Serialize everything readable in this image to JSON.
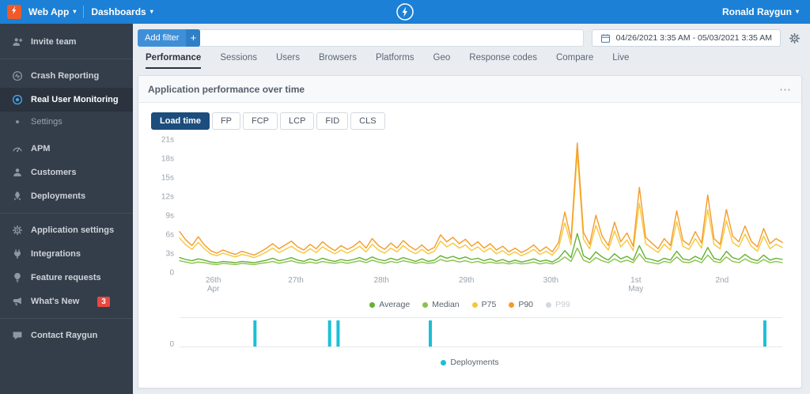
{
  "topbar": {
    "app_label": "Web App",
    "dashboards_label": "Dashboards",
    "user_label": "Ronald Raygun",
    "caret": "▾"
  },
  "sidebar": {
    "badge": "3",
    "items": [
      {
        "label": "Invite team"
      },
      {
        "label": "Crash Reporting"
      },
      {
        "label": "Real User Monitoring"
      },
      {
        "label": "Settings"
      },
      {
        "label": "APM"
      },
      {
        "label": "Customers"
      },
      {
        "label": "Deployments"
      },
      {
        "label": "Application settings"
      },
      {
        "label": "Integrations"
      },
      {
        "label": "Feature requests"
      },
      {
        "label": "What's New"
      },
      {
        "label": "Contact Raygun"
      }
    ]
  },
  "filters": {
    "add_filter_label": "Add filter",
    "add_filter_plus": "+",
    "date_range": "04/26/2021 3:35 AM - 05/03/2021 3:35 AM"
  },
  "tabs": [
    "Performance",
    "Sessions",
    "Users",
    "Browsers",
    "Platforms",
    "Geo",
    "Response codes",
    "Compare",
    "Live"
  ],
  "card": {
    "title": "Application performance over time",
    "menu_icon": "⋯"
  },
  "chips": [
    "Load time",
    "FP",
    "FCP",
    "LCP",
    "FID",
    "CLS"
  ],
  "chart_data": [
    {
      "type": "line",
      "title": "Application performance over time",
      "unit": "s",
      "ylim": [
        0,
        21
      ],
      "yticks": [
        0,
        3,
        6,
        9,
        12,
        15,
        18,
        21
      ],
      "legend_position": "bottom",
      "x_ticks": [
        {
          "label": "26th",
          "sub": "Apr",
          "frac": 0.056
        },
        {
          "label": "27th",
          "frac": 0.193
        },
        {
          "label": "28th",
          "frac": 0.335
        },
        {
          "label": "29th",
          "frac": 0.476
        },
        {
          "label": "30th",
          "frac": 0.616
        },
        {
          "label": "1st",
          "sub": "May",
          "frac": 0.757
        },
        {
          "label": "2nd",
          "frac": 0.9
        }
      ],
      "series": [
        {
          "name": "Average",
          "color": "#62b22f",
          "enabled": true,
          "values": [
            2.3,
            2.0,
            1.8,
            2.1,
            1.9,
            1.6,
            1.5,
            1.7,
            1.6,
            1.5,
            1.7,
            1.6,
            1.5,
            1.7,
            1.9,
            2.2,
            1.8,
            2.0,
            2.3,
            1.9,
            1.7,
            2.1,
            1.8,
            2.2,
            1.9,
            1.7,
            2.0,
            1.8,
            2.0,
            2.3,
            1.9,
            2.4,
            2.0,
            1.8,
            2.2,
            1.9,
            2.3,
            2.0,
            1.7,
            2.1,
            1.7,
            1.9,
            2.6,
            2.2,
            2.5,
            2.1,
            2.4,
            2.0,
            2.2,
            1.8,
            2.1,
            1.7,
            2.0,
            1.6,
            1.9,
            1.6,
            1.8,
            2.1,
            1.7,
            1.9,
            1.6,
            2.2,
            3.4,
            2.3,
            6.1,
            2.6,
            2.0,
            3.2,
            2.4,
            1.9,
            2.9,
            2.1,
            2.5,
            1.9,
            4.2,
            2.2,
            2.0,
            1.7,
            2.2,
            1.9,
            3.3,
            2.1,
            1.9,
            2.5,
            2.0,
            3.9,
            2.2,
            1.9,
            3.3,
            2.3,
            2.0,
            2.8,
            2.1,
            1.8,
            2.7,
            1.9,
            2.2,
            2.0
          ]
        },
        {
          "name": "Median",
          "color": "#8ac24a",
          "enabled": true,
          "values": [
            1.8,
            1.6,
            1.4,
            1.6,
            1.5,
            1.3,
            1.2,
            1.4,
            1.3,
            1.2,
            1.4,
            1.3,
            1.2,
            1.4,
            1.5,
            1.7,
            1.4,
            1.6,
            1.8,
            1.5,
            1.4,
            1.6,
            1.4,
            1.7,
            1.5,
            1.4,
            1.6,
            1.4,
            1.6,
            1.8,
            1.5,
            1.9,
            1.6,
            1.4,
            1.7,
            1.5,
            1.8,
            1.6,
            1.4,
            1.6,
            1.4,
            1.5,
            2.0,
            1.7,
            1.9,
            1.6,
            1.8,
            1.5,
            1.7,
            1.4,
            1.6,
            1.4,
            1.5,
            1.3,
            1.5,
            1.3,
            1.4,
            1.6,
            1.3,
            1.5,
            1.3,
            1.7,
            2.4,
            1.7,
            3.8,
            1.9,
            1.5,
            2.3,
            1.8,
            1.5,
            2.1,
            1.6,
            1.9,
            1.5,
            2.9,
            1.7,
            1.5,
            1.3,
            1.7,
            1.5,
            2.4,
            1.6,
            1.5,
            1.9,
            1.5,
            2.7,
            1.7,
            1.5,
            2.4,
            1.7,
            1.5,
            2.1,
            1.6,
            1.4,
            2.0,
            1.5,
            1.7,
            1.5
          ]
        },
        {
          "name": "P75",
          "color": "#f5c83b",
          "enabled": true,
          "values": [
            5.4,
            4.3,
            3.6,
            4.7,
            3.7,
            2.9,
            2.6,
            3.0,
            2.7,
            2.4,
            2.8,
            2.6,
            2.3,
            2.7,
            3.2,
            3.8,
            3.1,
            3.6,
            4.1,
            3.4,
            3.0,
            3.7,
            3.1,
            4.0,
            3.4,
            2.9,
            3.5,
            3.0,
            3.5,
            4.1,
            3.2,
            4.4,
            3.5,
            3.0,
            3.8,
            3.2,
            4.2,
            3.4,
            2.9,
            3.6,
            2.9,
            3.3,
            4.9,
            4.0,
            4.6,
            3.8,
            4.3,
            3.4,
            4.0,
            3.2,
            3.8,
            2.9,
            3.4,
            2.7,
            3.2,
            2.6,
            3.0,
            3.6,
            2.8,
            3.3,
            2.7,
            3.9,
            7.8,
            4.3,
            18.8,
            5.2,
            3.7,
            7.4,
            4.7,
            3.5,
            6.5,
            4.0,
            5.1,
            3.4,
            10.9,
            4.5,
            3.8,
            3.1,
            4.4,
            3.5,
            8.0,
            4.1,
            3.6,
            5.3,
            3.8,
            9.9,
            4.4,
            3.7,
            8.1,
            4.7,
            4.0,
            6.0,
            4.1,
            3.3,
            5.7,
            3.7,
            4.4,
            3.9
          ]
        },
        {
          "name": "P90",
          "color": "#f59b28",
          "enabled": true,
          "values": [
            6.4,
            5.1,
            4.2,
            5.6,
            4.3,
            3.4,
            3.0,
            3.5,
            3.1,
            2.8,
            3.3,
            3.0,
            2.7,
            3.2,
            3.8,
            4.5,
            3.7,
            4.3,
            4.9,
            4.0,
            3.5,
            4.4,
            3.7,
            4.8,
            4.0,
            3.4,
            4.2,
            3.6,
            4.1,
            4.9,
            3.8,
            5.3,
            4.2,
            3.6,
            4.6,
            3.8,
            5.0,
            4.1,
            3.5,
            4.3,
            3.4,
            3.9,
            5.9,
            4.8,
            5.5,
            4.5,
            5.2,
            4.1,
            4.8,
            3.8,
            4.5,
            3.5,
            4.1,
            3.2,
            3.8,
            3.1,
            3.6,
            4.3,
            3.3,
            4.0,
            3.2,
            4.7,
            9.5,
            5.2,
            20.4,
            6.3,
            4.4,
            9.0,
            5.7,
            4.2,
            7.9,
            4.8,
            6.2,
            4.1,
            13.4,
            5.5,
            4.6,
            3.7,
            5.3,
            4.2,
            9.7,
            5.0,
            4.3,
            6.4,
            4.6,
            12.2,
            5.3,
            4.4,
            9.9,
            5.7,
            4.8,
            7.3,
            4.9,
            4.0,
            6.9,
            4.5,
            5.3,
            4.7
          ]
        },
        {
          "name": "P99",
          "color": "#c9ced4",
          "enabled": false,
          "values": []
        }
      ]
    },
    {
      "type": "bar",
      "name": "Deployments",
      "color": "#1ac0d6",
      "baseline_label": "0",
      "positions_frac": [
        0.125,
        0.249,
        0.263,
        0.416,
        0.971
      ]
    }
  ]
}
